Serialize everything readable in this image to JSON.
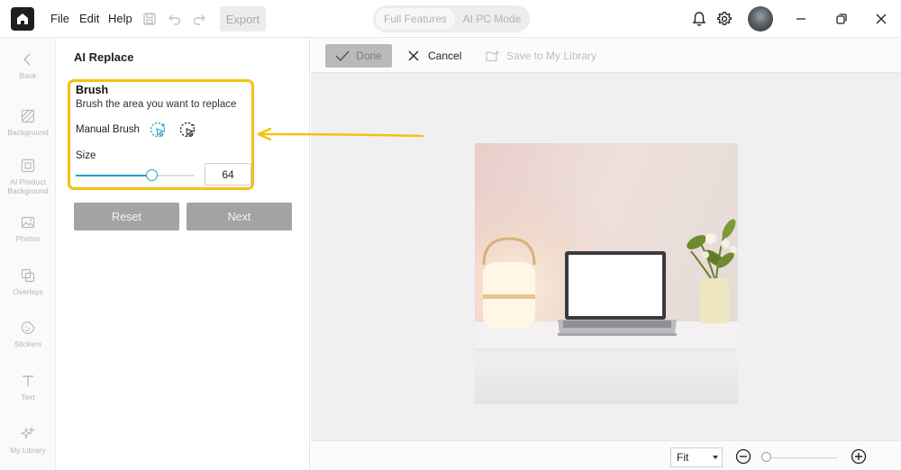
{
  "menu": {
    "file": "File",
    "edit": "Edit",
    "help": "Help",
    "export": "Export"
  },
  "mode": {
    "full_features": "Full Features",
    "ai_pc_mode": "AI PC Mode"
  },
  "rail": {
    "items": [
      {
        "label": "Back",
        "icon": "chevron-left-icon"
      },
      {
        "label": "Background",
        "icon": "background-icon"
      },
      {
        "label": "AI Product Background",
        "icon": "ai-product-background-icon"
      },
      {
        "label": "Photos",
        "icon": "photos-icon"
      },
      {
        "label": "Overlays",
        "icon": "overlays-icon"
      },
      {
        "label": "Stickers",
        "icon": "stickers-icon"
      },
      {
        "label": "Text",
        "icon": "text-icon"
      },
      {
        "label": "My Library",
        "icon": "my-library-icon"
      }
    ]
  },
  "panel": {
    "title": "AI Replace",
    "brush_title": "Brush",
    "brush_desc": "Brush the area you want to replace",
    "manual_brush": "Manual Brush",
    "size_label": "Size",
    "size_value": "64",
    "size_fraction": 0.64,
    "reset": "Reset",
    "next": "Next"
  },
  "canvas": {
    "done": "Done",
    "cancel": "Cancel",
    "save_library": "Save to My Library",
    "fit": "Fit",
    "zoom_fraction": 0.0
  },
  "colors": {
    "highlight": "#f4c20d",
    "accent": "#1aa6c4",
    "disabled_button": "#a3a3a3"
  }
}
